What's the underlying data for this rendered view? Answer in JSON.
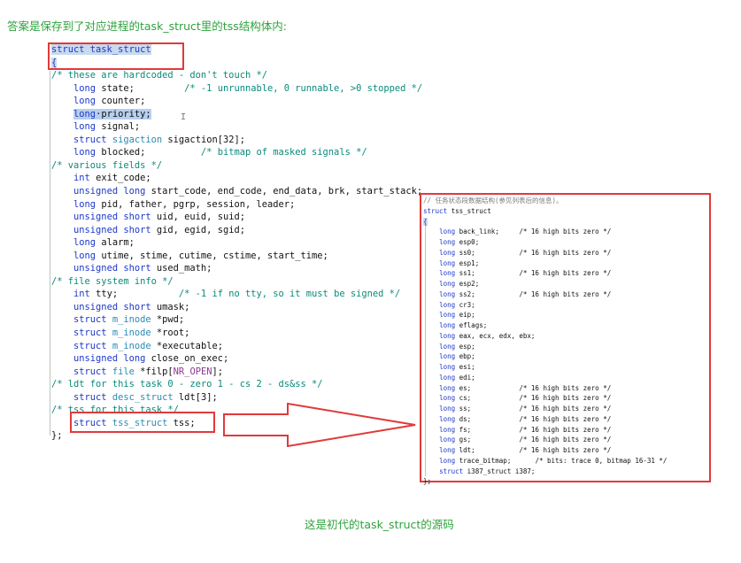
{
  "heading": "答案是保存到了对应进程的task_struct里的tss结构体内:",
  "caption": "这是初代的task_struct的源码",
  "colors": {
    "accent_green": "#2fa33e",
    "box_red": "#e03a3a",
    "keyword_blue": "#1c37c9",
    "type_teal": "#2b8bb3",
    "comment_green": "#0a8a7a"
  },
  "left_code": [
    [
      [
        "struct task_struct",
        "kw hl"
      ]
    ],
    [
      [
        "{",
        "brace hl"
      ]
    ],
    [
      [
        "/* these are hardcoded - don't touch */",
        "cm"
      ]
    ],
    [
      [
        "    ",
        ""
      ],
      [
        "long",
        "kw"
      ],
      [
        " state;         ",
        "id"
      ],
      [
        "/* -1 unrunnable, 0 runnable, >0 stopped */",
        "cm"
      ]
    ],
    [
      [
        "    ",
        ""
      ],
      [
        "long",
        "kw"
      ],
      [
        " counter;",
        "id"
      ]
    ],
    [
      [
        "    ",
        ""
      ],
      [
        "long",
        "kw hlblue"
      ],
      [
        "·priority;",
        "id hlblue"
      ]
    ],
    [
      [
        "    ",
        ""
      ],
      [
        "long",
        "kw"
      ],
      [
        " signal;",
        "id"
      ]
    ],
    [
      [
        "    ",
        ""
      ],
      [
        "struct",
        "kw"
      ],
      [
        " ",
        ""
      ],
      [
        "sigaction",
        "ty"
      ],
      [
        " sigaction[32];",
        "id"
      ]
    ],
    [
      [
        "    ",
        ""
      ],
      [
        "long",
        "kw"
      ],
      [
        " blocked;          ",
        "id"
      ],
      [
        "/* bitmap of masked signals */",
        "cm"
      ]
    ],
    [
      [
        "/* various fields */",
        "cm"
      ]
    ],
    [
      [
        "    ",
        ""
      ],
      [
        "int",
        "kw"
      ],
      [
        " exit_code;",
        "id"
      ]
    ],
    [
      [
        "    ",
        ""
      ],
      [
        "unsigned long",
        "kw"
      ],
      [
        " start_code, end_code, end_data, brk, start_stack;",
        "id"
      ]
    ],
    [
      [
        "    ",
        ""
      ],
      [
        "long",
        "kw"
      ],
      [
        " pid, father, pgrp, session, leader;",
        "id"
      ]
    ],
    [
      [
        "    ",
        ""
      ],
      [
        "unsigned short",
        "kw"
      ],
      [
        " uid, euid, suid;",
        "id"
      ]
    ],
    [
      [
        "    ",
        ""
      ],
      [
        "unsigned short",
        "kw"
      ],
      [
        " gid, egid, sgid;",
        "id"
      ]
    ],
    [
      [
        "    ",
        ""
      ],
      [
        "long",
        "kw"
      ],
      [
        " alarm;",
        "id"
      ]
    ],
    [
      [
        "    ",
        ""
      ],
      [
        "long",
        "kw"
      ],
      [
        " utime, stime, cutime, cstime, start_time;",
        "id"
      ]
    ],
    [
      [
        "    ",
        ""
      ],
      [
        "unsigned short",
        "kw"
      ],
      [
        " used_math;",
        "id"
      ]
    ],
    [
      [
        "/* file system info */",
        "cm"
      ]
    ],
    [
      [
        "    ",
        ""
      ],
      [
        "int",
        "kw"
      ],
      [
        " tty;           ",
        "id"
      ],
      [
        "/* -1 if no tty, so it must be signed */",
        "cm"
      ]
    ],
    [
      [
        "    ",
        ""
      ],
      [
        "unsigned short",
        "kw"
      ],
      [
        " umask;",
        "id"
      ]
    ],
    [
      [
        "    ",
        ""
      ],
      [
        "struct",
        "kw"
      ],
      [
        " ",
        ""
      ],
      [
        "m_inode",
        "ty"
      ],
      [
        " *pwd;",
        "id"
      ]
    ],
    [
      [
        "    ",
        ""
      ],
      [
        "struct",
        "kw"
      ],
      [
        " ",
        ""
      ],
      [
        "m_inode",
        "ty"
      ],
      [
        " *root;",
        "id"
      ]
    ],
    [
      [
        "    ",
        ""
      ],
      [
        "struct",
        "kw"
      ],
      [
        " ",
        ""
      ],
      [
        "m_inode",
        "ty"
      ],
      [
        " *executable;",
        "id"
      ]
    ],
    [
      [
        "    ",
        ""
      ],
      [
        "unsigned long",
        "kw"
      ],
      [
        " close_on_exec;",
        "id"
      ]
    ],
    [
      [
        "    ",
        ""
      ],
      [
        "struct",
        "kw"
      ],
      [
        " ",
        ""
      ],
      [
        "file",
        "ty"
      ],
      [
        " *filp[",
        "id"
      ],
      [
        "NR_OPEN",
        "mac"
      ],
      [
        "];",
        "id"
      ]
    ],
    [
      [
        "/* ldt for this task 0 - zero 1 - cs 2 - ds&ss */",
        "cm"
      ]
    ],
    [
      [
        "    ",
        ""
      ],
      [
        "struct",
        "kw"
      ],
      [
        " ",
        ""
      ],
      [
        "desc_struct",
        "ty"
      ],
      [
        " ldt[3];",
        "id"
      ]
    ],
    [
      [
        "/* tss for this task */",
        "cm"
      ]
    ],
    [
      [
        "    ",
        ""
      ],
      [
        "struct",
        "kw"
      ],
      [
        " ",
        ""
      ],
      [
        "tss_struct",
        "ty"
      ],
      [
        " tss;",
        "id"
      ]
    ],
    [
      [
        "};",
        "id"
      ]
    ]
  ],
  "right_code": [
    [
      [
        "// 任务状态段数据结构(参见列表后的信息)。",
        "cmr"
      ]
    ],
    [
      [
        "struct",
        "kw"
      ],
      [
        " tss_struct",
        "id"
      ]
    ],
    [
      [
        "{",
        "brace hl"
      ]
    ],
    [
      [
        "    ",
        ""
      ],
      [
        "long",
        "kw"
      ],
      [
        " back_link;     ",
        "id"
      ],
      [
        "/* 16 high bits zero */",
        "id"
      ]
    ],
    [
      [
        "    ",
        ""
      ],
      [
        "long",
        "kw"
      ],
      [
        " esp0;",
        "id"
      ]
    ],
    [
      [
        "    ",
        ""
      ],
      [
        "long",
        "kw"
      ],
      [
        " ss0;           ",
        "id"
      ],
      [
        "/* 16 high bits zero */",
        "id"
      ]
    ],
    [
      [
        "    ",
        ""
      ],
      [
        "long",
        "kw"
      ],
      [
        " esp1;",
        "id"
      ]
    ],
    [
      [
        "    ",
        ""
      ],
      [
        "long",
        "kw"
      ],
      [
        " ss1;           ",
        "id"
      ],
      [
        "/* 16 high bits zero */",
        "id"
      ]
    ],
    [
      [
        "    ",
        ""
      ],
      [
        "long",
        "kw"
      ],
      [
        " esp2;",
        "id"
      ]
    ],
    [
      [
        "    ",
        ""
      ],
      [
        "long",
        "kw"
      ],
      [
        " ss2;           ",
        "id"
      ],
      [
        "/* 16 high bits zero */",
        "id"
      ]
    ],
    [
      [
        "    ",
        ""
      ],
      [
        "long",
        "kw"
      ],
      [
        " cr3;",
        "id"
      ]
    ],
    [
      [
        "    ",
        ""
      ],
      [
        "long",
        "kw"
      ],
      [
        " eip;",
        "id"
      ]
    ],
    [
      [
        "    ",
        ""
      ],
      [
        "long",
        "kw"
      ],
      [
        " eflags;",
        "id"
      ]
    ],
    [
      [
        "    ",
        ""
      ],
      [
        "long",
        "kw"
      ],
      [
        " eax, ecx, edx, ebx;",
        "id"
      ]
    ],
    [
      [
        "    ",
        ""
      ],
      [
        "long",
        "kw"
      ],
      [
        " esp;",
        "id"
      ]
    ],
    [
      [
        "    ",
        ""
      ],
      [
        "long",
        "kw"
      ],
      [
        " ebp;",
        "id"
      ]
    ],
    [
      [
        "    ",
        ""
      ],
      [
        "long",
        "kw"
      ],
      [
        " esi;",
        "id"
      ]
    ],
    [
      [
        "    ",
        ""
      ],
      [
        "long",
        "kw"
      ],
      [
        " edi;",
        "id"
      ]
    ],
    [
      [
        "    ",
        ""
      ],
      [
        "long",
        "kw"
      ],
      [
        " es;            ",
        "id"
      ],
      [
        "/* 16 high bits zero */",
        "id"
      ]
    ],
    [
      [
        "    ",
        ""
      ],
      [
        "long",
        "kw"
      ],
      [
        " cs;            ",
        "id"
      ],
      [
        "/* 16 high bits zero */",
        "id"
      ]
    ],
    [
      [
        "    ",
        ""
      ],
      [
        "long",
        "kw"
      ],
      [
        " ss;            ",
        "id"
      ],
      [
        "/* 16 high bits zero */",
        "id"
      ]
    ],
    [
      [
        "    ",
        ""
      ],
      [
        "long",
        "kw"
      ],
      [
        " ds;            ",
        "id"
      ],
      [
        "/* 16 high bits zero */",
        "id"
      ]
    ],
    [
      [
        "    ",
        ""
      ],
      [
        "long",
        "kw"
      ],
      [
        " fs;            ",
        "id"
      ],
      [
        "/* 16 high bits zero */",
        "id"
      ]
    ],
    [
      [
        "    ",
        ""
      ],
      [
        "long",
        "kw"
      ],
      [
        " gs;            ",
        "id"
      ],
      [
        "/* 16 high bits zero */",
        "id"
      ]
    ],
    [
      [
        "    ",
        ""
      ],
      [
        "long",
        "kw"
      ],
      [
        " ldt;           ",
        "id"
      ],
      [
        "/* 16 high bits zero */",
        "id"
      ]
    ],
    [
      [
        "    ",
        ""
      ],
      [
        "long",
        "kw"
      ],
      [
        " trace_bitmap;      ",
        "id"
      ],
      [
        "/* bits: trace 0, bitmap 16-31 */",
        "id"
      ]
    ],
    [
      [
        "    ",
        ""
      ],
      [
        "struct",
        "kw"
      ],
      [
        " i387_struct i387;",
        "id"
      ]
    ],
    [
      [
        "};",
        "id"
      ]
    ]
  ]
}
